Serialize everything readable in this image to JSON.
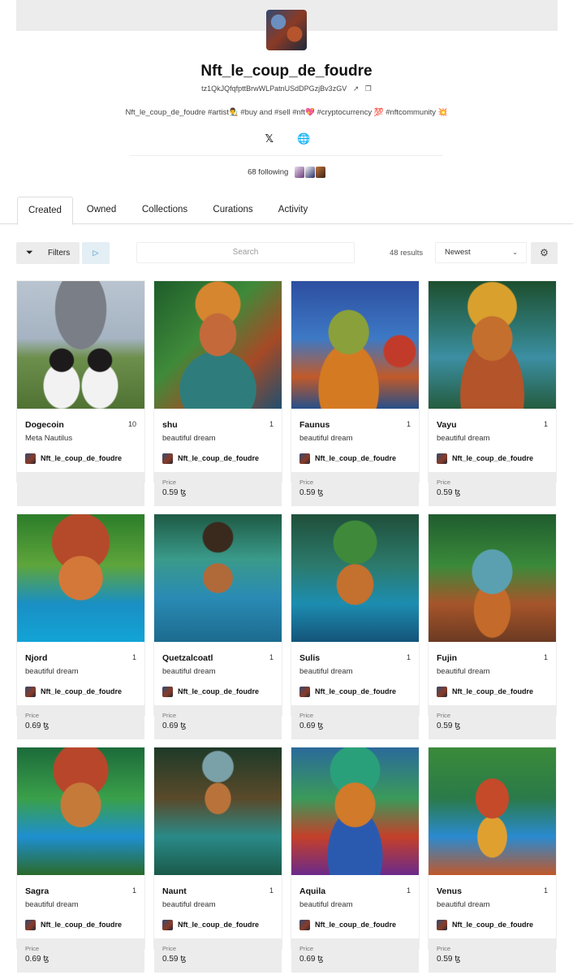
{
  "profile": {
    "name": "Nft_le_coup_de_foudre",
    "address": "tz1QkJQfqfpttBrwWLPatnUSdDPGzjBv3zGV",
    "bio": "Nft_le_coup_de_foudre #artist👨‍🎨 #buy and #sell #nft💖 #cryptocurrency 💯 #nftcommunity 💥",
    "following": "68 following"
  },
  "icons": {
    "link": "external-link-icon",
    "copy": "copy-icon",
    "x": "x-twitter-icon",
    "web": "globe-icon",
    "filter": "filter-icon",
    "play": "play-icon",
    "chevron": "chevron-down-icon",
    "settings": "gear-icon"
  },
  "tabs": [
    "Created",
    "Owned",
    "Collections",
    "Curations",
    "Activity"
  ],
  "toolbar": {
    "filters_label": "Filters",
    "search_placeholder": "Search",
    "results": "48 results",
    "sort_value": "Newest"
  },
  "cards": [
    {
      "title": "Dogecoin",
      "edition": "10",
      "subtitle": "Meta Nautilus",
      "creator": "Nft_le_coup_de_foudre",
      "price_label": "",
      "price": ""
    },
    {
      "title": "shu",
      "edition": "1",
      "subtitle": "beautiful dream",
      "creator": "Nft_le_coup_de_foudre",
      "price_label": "Price",
      "price": "0.59 ꜩ"
    },
    {
      "title": "Faunus",
      "edition": "1",
      "subtitle": "beautiful dream",
      "creator": "Nft_le_coup_de_foudre",
      "price_label": "Price",
      "price": "0.59 ꜩ"
    },
    {
      "title": "Vayu",
      "edition": "1",
      "subtitle": "beautiful dream",
      "creator": "Nft_le_coup_de_foudre",
      "price_label": "Price",
      "price": "0.59 ꜩ"
    },
    {
      "title": "Njord",
      "edition": "1",
      "subtitle": "beautiful dream",
      "creator": "Nft_le_coup_de_foudre",
      "price_label": "Price",
      "price": "0.69 ꜩ"
    },
    {
      "title": "Quetzalcoatl",
      "edition": "1",
      "subtitle": "beautiful dream",
      "creator": "Nft_le_coup_de_foudre",
      "price_label": "Price",
      "price": "0.69 ꜩ"
    },
    {
      "title": "Sulis",
      "edition": "1",
      "subtitle": "beautiful dream",
      "creator": "Nft_le_coup_de_foudre",
      "price_label": "Price",
      "price": "0.69 ꜩ"
    },
    {
      "title": "Fujin",
      "edition": "1",
      "subtitle": "beautiful dream",
      "creator": "Nft_le_coup_de_foudre",
      "price_label": "Price",
      "price": "0.59 ꜩ"
    },
    {
      "title": "Sagra",
      "edition": "1",
      "subtitle": "beautiful dream",
      "creator": "Nft_le_coup_de_foudre",
      "price_label": "Price",
      "price": "0.69 ꜩ"
    },
    {
      "title": "Naunt",
      "edition": "1",
      "subtitle": "beautiful dream",
      "creator": "Nft_le_coup_de_foudre",
      "price_label": "Price",
      "price": "0.59 ꜩ"
    },
    {
      "title": "Aquila",
      "edition": "1",
      "subtitle": "beautiful dream",
      "creator": "Nft_le_coup_de_foudre",
      "price_label": "Price",
      "price": "0.69 ꜩ"
    },
    {
      "title": "Venus",
      "edition": "1",
      "subtitle": "beautiful dream",
      "creator": "Nft_le_coup_de_foudre",
      "price_label": "Price",
      "price": "0.59 ꜩ"
    }
  ]
}
